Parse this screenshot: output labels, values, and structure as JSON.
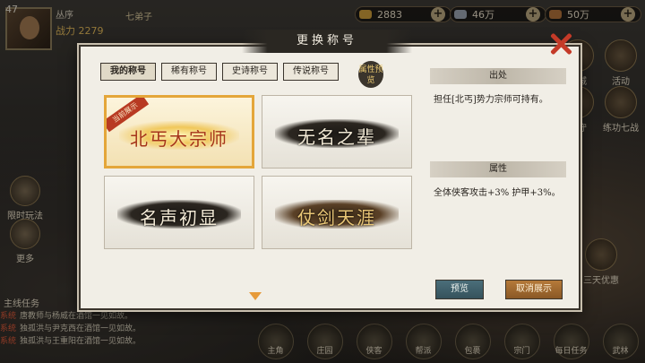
{
  "player": {
    "level": "47",
    "name": "丛序",
    "power_label": "战力",
    "power": "2279",
    "badge": "七弟子"
  },
  "resources": [
    {
      "icon": "gold-ingot-icon",
      "value": "2883"
    },
    {
      "icon": "silver-icon",
      "value": "46万"
    },
    {
      "icon": "copper-icon",
      "value": "50万"
    }
  ],
  "right_menu": [
    {
      "label": "商城"
    },
    {
      "label": "活动"
    },
    {
      "label": "国守"
    },
    {
      "label": "练功七战"
    },
    {
      "label": "三天优惠"
    }
  ],
  "left_menu": [
    {
      "label": "限时玩法"
    },
    {
      "label": "更多"
    }
  ],
  "quest": {
    "label": "主线任务"
  },
  "chat": [
    {
      "tag": "系统",
      "text": "唐教师与杨威在酒馆一见如故。"
    },
    {
      "tag": "系统",
      "text": "独孤洪与尹克西在酒馆一见如故。"
    },
    {
      "tag": "系统",
      "text": "独孤洪与王重阳在酒馆一见如故。"
    }
  ],
  "bottom_bar": [
    "主角",
    "庄园",
    "侠客",
    "帮派",
    "包裹",
    "宗门",
    "每日任务",
    "武林"
  ],
  "dialog": {
    "title": "更换称号",
    "tabs": [
      "我的称号",
      "稀有称号",
      "史诗称号",
      "传说称号"
    ],
    "preview_seal": "属性预览",
    "titles": [
      {
        "name": "北丐大宗师",
        "ribbon": "当前展示",
        "selected": true
      },
      {
        "name": "无名之辈",
        "ribbon": "",
        "selected": false
      },
      {
        "name": "名声初显",
        "ribbon": "",
        "selected": false
      },
      {
        "name": "仗剑天涯",
        "ribbon": "",
        "selected": false
      }
    ],
    "source_heading": "出处",
    "source_text": "担任[北丐]势力宗师可持有。",
    "attr_heading": "属性",
    "attr_text": "全体侠客攻击+3% 护甲+3%。",
    "preview_button": "预览",
    "cancel_button": "取消展示"
  },
  "colors": {
    "accent": "#e4a63a",
    "close": "#c43a28",
    "preview_btn": "#4b6e7a",
    "cancel_btn": "#b57a3a"
  }
}
